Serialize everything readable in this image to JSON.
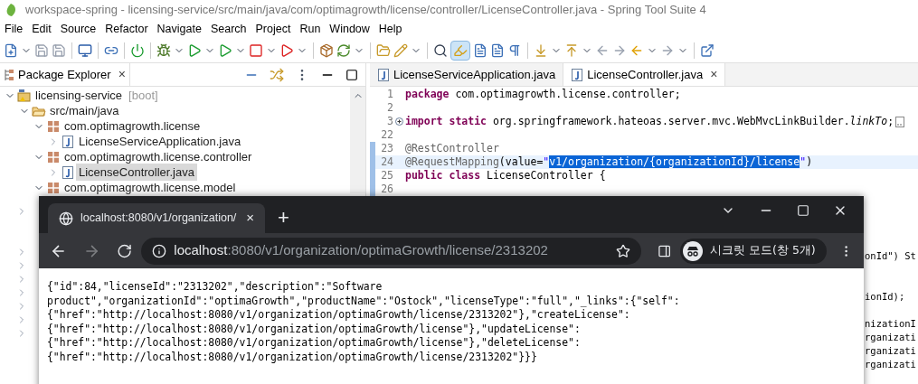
{
  "window": {
    "title": "workspace-spring - licensing-service/src/main/java/com/optimagrowth/license/controller/LicenseController.java - Spring Tool Suite 4"
  },
  "menu": [
    "File",
    "Edit",
    "Source",
    "Refactor",
    "Navigate",
    "Search",
    "Project",
    "Run",
    "Window",
    "Help"
  ],
  "toolbar": {
    "highlight_toggle_selected": true
  },
  "package_explorer": {
    "title": "Package Explorer",
    "close": "×",
    "tree": [
      {
        "kind": "project",
        "name": "licensing-service",
        "tag": "[boot]",
        "expanded": true,
        "selected": false,
        "children": [
          {
            "kind": "folder",
            "name": "src/main/java",
            "expanded": true,
            "selected": false,
            "children": [
              {
                "kind": "package",
                "name": "com.optimagrowth.license",
                "expanded": true,
                "selected": false,
                "children": [
                  {
                    "kind": "file",
                    "name": "LicenseServiceApplication.java",
                    "expanded": false,
                    "selected": false
                  }
                ]
              },
              {
                "kind": "package",
                "name": "com.optimagrowth.license.controller",
                "expanded": true,
                "selected": false,
                "children": [
                  {
                    "kind": "file",
                    "name": "LicenseController.java",
                    "expanded": false,
                    "selected": true
                  }
                ]
              },
              {
                "kind": "package",
                "name": "com.optimagrowth.license.model",
                "expanded": true,
                "selected": false
              }
            ]
          }
        ]
      }
    ]
  },
  "editor": {
    "tabs": [
      {
        "label": "LicenseServiceApplication.java",
        "selected": false
      },
      {
        "label": "LicenseController.java",
        "selected": true,
        "close": "×"
      }
    ],
    "lines": [
      {
        "number": "1",
        "changed": false,
        "current": false,
        "folded": false,
        "tokens": [
          {
            "kind": "keyword",
            "text": "package"
          },
          {
            "kind": "plain",
            "text": " com.optimagrowth.license.controller;"
          }
        ]
      },
      {
        "number": "2",
        "changed": false,
        "current": false
      },
      {
        "number": "3",
        "changed": false,
        "current": false,
        "folded": true,
        "tokens": [
          {
            "kind": "keyword",
            "text": "import "
          },
          {
            "kind": "keyword",
            "text": "static"
          },
          {
            "kind": "plain",
            "text": " org.springframework.hateoas.server.mvc.WebMvcLinkBuilder."
          },
          {
            "kind": "italic",
            "text": "linkTo"
          },
          {
            "kind": "plain",
            "text": ";"
          }
        ]
      },
      {
        "number": "22",
        "changed": false,
        "current": false
      },
      {
        "number": "23",
        "changed": true,
        "current": false,
        "folded": false,
        "tokens": [
          {
            "kind": "annotation",
            "text": "@RestController"
          }
        ]
      },
      {
        "number": "24",
        "changed": true,
        "current": true,
        "folded": false,
        "tokens": [
          {
            "kind": "annotation",
            "text": "@RequestMapping"
          },
          {
            "kind": "plain",
            "text": "(value="
          },
          {
            "kind": "string",
            "text": "\""
          },
          {
            "kind": "selection",
            "text": "v1/organization/{organizationId}/license"
          },
          {
            "kind": "string",
            "text": "\""
          },
          {
            "kind": "plain",
            "text": ")"
          }
        ]
      },
      {
        "number": "25",
        "changed": true,
        "current": false,
        "folded": false,
        "tokens": [
          {
            "kind": "keyword",
            "text": "public "
          },
          {
            "kind": "keyword",
            "text": "class"
          },
          {
            "kind": "plain",
            "text": " LicenseController {"
          }
        ]
      },
      {
        "number": "26",
        "changed": true,
        "current": false
      }
    ],
    "uncovered_fragments": [
      {
        "kind": "code",
        "text": "onId\") St"
      },
      {
        "kind": "blank"
      },
      {
        "kind": "blank"
      },
      {
        "kind": "code",
        "text": "ionId);"
      },
      {
        "kind": "blank"
      },
      {
        "kind": "code",
        "text": "nizationI"
      },
      {
        "kind": "code",
        "text": "rganizati"
      },
      {
        "kind": "code",
        "text": "rganizati"
      },
      {
        "kind": "code",
        "text": "rganizati"
      }
    ]
  },
  "browser": {
    "tab": {
      "title": "localhost:8080/v1/organization/",
      "close": "×"
    },
    "new_tab": "+",
    "address": {
      "host": "localhost",
      "rest": ":8080/v1/organization/optimaGrowth/license/2313202"
    },
    "incognito": "시크릿 모드(창 5개)",
    "body_lines": [
      "{\"id\":84,\"licenseId\":\"2313202\",\"description\":\"Software",
      "product\",\"organizationId\":\"optimaGrowth\",\"productName\":\"Ostock\",\"licenseType\":\"full\",\"_links\":{\"self\":",
      "{\"href\":\"http://localhost:8080/v1/organization/optimaGrowth/license/2313202\"},\"createLicense\":",
      "{\"href\":\"http://localhost:8080/v1/organization/optimaGrowth/license\"},\"updateLicense\":",
      "{\"href\":\"http://localhost:8080/v1/organization/optimaGrowth/license\"},\"deleteLicense\":",
      "{\"href\":\"http://localhost:8080/v1/organization/optimaGrowth/license/2313202\"}}}"
    ]
  }
}
